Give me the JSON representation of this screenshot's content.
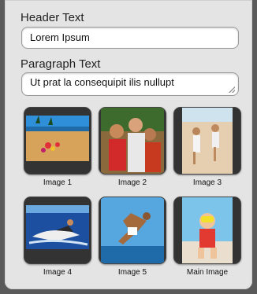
{
  "form": {
    "header_label": "Header Text",
    "header_value": "Lorem Ipsum",
    "paragraph_label": "Paragraph Text",
    "paragraph_line1": "Ut prat la consequipit ilis nullupt",
    "paragraph_line2": ".... ...... .. ... ......... ......"
  },
  "images": [
    {
      "caption": "Image 1",
      "icon": "beach-flowers-photo"
    },
    {
      "caption": "Image 2",
      "icon": "friends-photo"
    },
    {
      "caption": "Image 3",
      "icon": "beach-runners-photo"
    },
    {
      "caption": "Image 4",
      "icon": "jetski-photo"
    },
    {
      "caption": "Image 5",
      "icon": "diver-photo"
    },
    {
      "caption": "Main Image",
      "icon": "kid-snorkel-photo"
    }
  ]
}
